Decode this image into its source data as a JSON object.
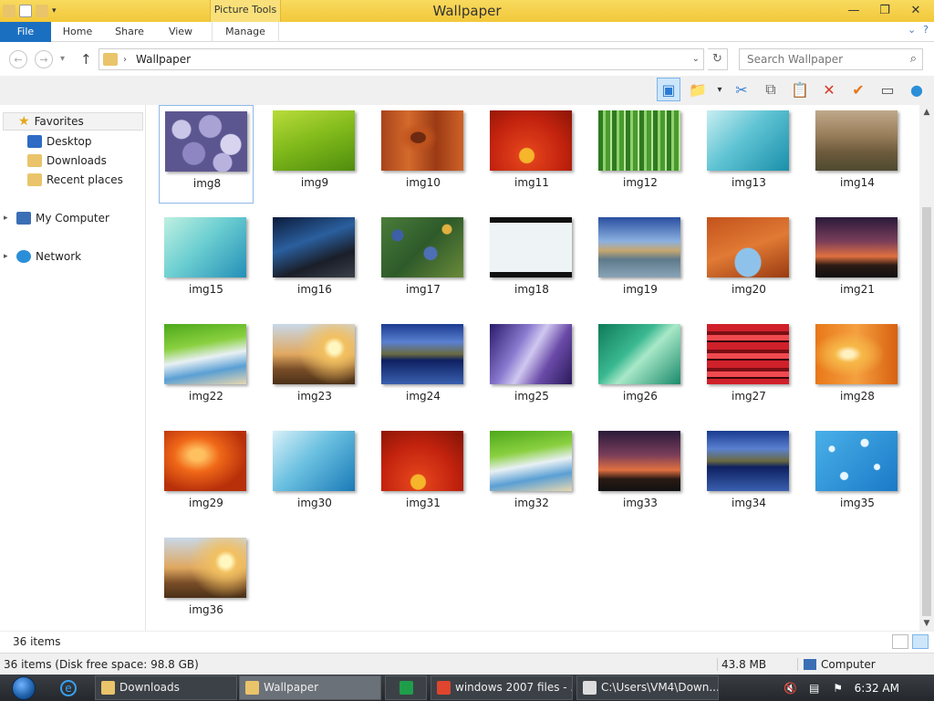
{
  "window": {
    "title": "Wallpaper",
    "context_tab": "Picture Tools",
    "minimize": "—",
    "maximize": "❐",
    "close": "✕"
  },
  "ribbon": {
    "tabs": [
      "File",
      "Home",
      "Share",
      "View",
      "Manage"
    ],
    "collapse_icon": "⌄",
    "help_icon": "?"
  },
  "address": {
    "back": "←",
    "forward": "→",
    "recent": "▾",
    "up": "↑",
    "separator": "›",
    "path": "Wallpaper",
    "dropdown": "⌄",
    "refresh": "↻",
    "search_placeholder": "Search Wallpaper",
    "search_icon": "⌕"
  },
  "toolbar": {
    "icons": [
      {
        "name": "preview-pane-icon",
        "glyph": "▣",
        "color": "#2a7bd4",
        "selected": true
      },
      {
        "name": "folder-options-icon",
        "glyph": "📁",
        "color": "#c99a2e",
        "selected": false
      },
      {
        "name": "dropdown-arrow-icon",
        "glyph": "▾",
        "color": "#333333",
        "selected": false
      },
      {
        "name": "cut-icon",
        "glyph": "✂",
        "color": "#3a7fd0",
        "selected": false
      },
      {
        "name": "copy-icon",
        "glyph": "⧉",
        "color": "#666666",
        "selected": false
      },
      {
        "name": "paste-icon",
        "glyph": "📋",
        "color": "#9a7a3c",
        "selected": false
      },
      {
        "name": "delete-icon",
        "glyph": "✕",
        "color": "#d63a2a",
        "selected": false
      },
      {
        "name": "rename-check-icon",
        "glyph": "✔",
        "color": "#e6761c",
        "selected": false
      },
      {
        "name": "properties-icon",
        "glyph": "▭",
        "color": "#555555",
        "selected": false
      },
      {
        "name": "globe-icon",
        "glyph": "●",
        "color": "#2b8fd8",
        "selected": false
      }
    ]
  },
  "nav": {
    "favorites": "Favorites",
    "desktop": "Desktop",
    "downloads": "Downloads",
    "recent": "Recent places",
    "computer": "My Computer",
    "network": "Network",
    "expand_icon": "▸"
  },
  "files": [
    {
      "label": "img8",
      "bg": "radial-gradient(circle at 20% 30%,#c9c6e8 0 10px,transparent 11px),radial-gradient(circle at 55% 25%,#a8a3d4 0 12px,transparent 13px),radial-gradient(circle at 80% 55%,#d8d4f0 0 11px,transparent 12px),radial-gradient(circle at 35% 70%,#8d86c2 0 12px,transparent 13px),radial-gradient(circle at 70% 85%,#b7b2de 0 10px,transparent 11px),#5c5690"
    },
    {
      "label": "img9",
      "bg": "linear-gradient(160deg,#b8dc3a 0%,#7fb81a 50%,#4f8d0e 100%)"
    },
    {
      "label": "img10",
      "bg": "radial-gradient(ellipse at 45% 45%,#6d2a10 0 8px,#c0531d 9px,transparent 22px),linear-gradient(90deg,#a8441a,#d46a2c,#9c3a14,#cf6228)"
    },
    {
      "label": "img11",
      "bg": "radial-gradient(circle at 45% 75%,#f6b52a 0 8px,#e0401a 9px,#c3230e 40px,#8a1506 70px)"
    },
    {
      "label": "img12",
      "bg": "repeating-linear-gradient(90deg,#2f7a22 0 5px,#8fd16a 5px 8px,#4a9a30 8px 13px,#b8e59a 13px 15px)"
    },
    {
      "label": "img13",
      "bg": "linear-gradient(135deg,#c8eef2 0%,#5fc3d3 45%,#1a8fab 100%)"
    },
    {
      "label": "img14",
      "bg": "linear-gradient(180deg,#bfa88a 0%,#9a7f5c 40%,#6d5a3c 70%,#4e4a30 100%)"
    },
    {
      "label": "img15",
      "bg": "linear-gradient(135deg,#bff0e2 0%,#6dcfd1 45%,#248fb8 100%)"
    },
    {
      "label": "img16",
      "bg": "linear-gradient(160deg,#0c1b3a 0%,#2a5f9e 40%,#1a1e28 70%,#3b3f48 100%)"
    },
    {
      "label": "img17",
      "bg": "radial-gradient(circle at 20% 30%,#3d5fa8 0 6px,transparent 7px),radial-gradient(circle at 60% 60%,#4d6fb5 0 7px,transparent 8px),radial-gradient(circle at 80% 20%,#e0b040 0 5px,transparent 6px),linear-gradient(135deg,#4a7d3a,#2e5a2a,#6a8a3a)"
    },
    {
      "label": "img18",
      "bg": "linear-gradient(180deg,#111 0 6px,#eef3f6 6px 60px,#111 60px),radial-gradient(ellipse at 50% 55%,#4a7aa0 0 30px,transparent 31px)"
    },
    {
      "label": "img19",
      "bg": "linear-gradient(180deg,#2a4fa0 0%,#8bb0e0 40%,#c7a870 55%,#5e7a8a 70%,#8aa4b8 100%)"
    },
    {
      "label": "img20",
      "bg": "radial-gradient(ellipse at 50% 75%,#8fc2ea 0 14px,transparent 15px),linear-gradient(160deg,#c4521c,#e07a34,#9a3a12)"
    },
    {
      "label": "img21",
      "bg": "linear-gradient(180deg,#2a1a3a 0%,#7a3e5a 40%,#e07040 65%,#2a1a14 80%,#111 100%)"
    },
    {
      "label": "img22",
      "bg": "linear-gradient(170deg,#4ca81a 0%,#8ad040 35%,#e8f0f4 55%,#5a9fd4 75%,#e8d8b0 100%)"
    },
    {
      "label": "img23",
      "bg": "radial-gradient(circle at 75% 40%,#fff6c0 0 6px,#f2c060 12px,transparent 40px),linear-gradient(180deg,#c8d8e8 0%,#e0a860 50%,#7a4e28 75%,#4a3018 100%)"
    },
    {
      "label": "img24",
      "bg": "linear-gradient(180deg,#1a3a90 0%,#5a80d0 30%,#6a6a40 50%,#0e2060 60%,#3a60b0 100%)"
    },
    {
      "label": "img25",
      "bg": "linear-gradient(120deg,#2a1a6a 0%,#8a7ad0 35%,#d0c8f0 50%,#6a4aa8 70%,#2a1a5a 100%)"
    },
    {
      "label": "img26",
      "bg": "linear-gradient(135deg,#0e7a58 0%,#3ab890 40%,#a8e8c8 55%,#1a8a6a 100%)"
    },
    {
      "label": "img27",
      "bg": "repeating-linear-gradient(180deg,#d0202a 0 8px,#7a0e14 8px 12px,#f04a50 12px 18px,#3a0608 18px 20px)"
    },
    {
      "label": "img28",
      "bg": "radial-gradient(ellipse at 40% 50%,#fff0c0 0 6px,#f6b848 15px,transparent 40px),linear-gradient(90deg,#e8781a,#f5a040,#d86010)"
    },
    {
      "label": "img29",
      "bg": "radial-gradient(ellipse at 40% 40%,#ffc060 0 8px,#f06818 25px,#b8300a 55px)"
    },
    {
      "label": "img30",
      "bg": "linear-gradient(135deg,#d8f0f8 0%,#6ac0e0 45%,#1a7ab8 100%)"
    },
    {
      "label": "img31",
      "bg": "radial-gradient(circle at 45% 85%,#f6b52a 0 8px,#e0401a 9px,#c3230e 40px,#8a1506 70px)"
    },
    {
      "label": "img32",
      "bg": "linear-gradient(170deg,#4ca81a 0%,#8ad040 35%,#e8f0f4 55%,#5a9fd4 75%,#e8d8b0 100%)"
    },
    {
      "label": "img33",
      "bg": "linear-gradient(180deg,#2a1a3a 0%,#7a3e5a 40%,#e07040 65%,#2a1a14 80%,#111 100%)"
    },
    {
      "label": "img34",
      "bg": "linear-gradient(180deg,#1a3a90 0%,#5a80d0 30%,#6a6a40 50%,#0e2060 60%,#3a60b0 100%)"
    },
    {
      "label": "img35",
      "bg": "radial-gradient(circle at 20% 30%,#e8f6ff 0 3px,transparent 4px),radial-gradient(circle at 60% 20%,#e8f6ff 0 4px,transparent 5px),radial-gradient(circle at 75% 60%,#e8f6ff 0 3px,transparent 4px),radial-gradient(circle at 35% 75%,#e8f6ff 0 4px,transparent 5px),linear-gradient(135deg,#4ab0e8,#1a7ac8)"
    },
    {
      "label": "img36",
      "bg": "radial-gradient(circle at 75% 40%,#fff6c0 0 6px,#f2c060 12px,transparent 40px),linear-gradient(180deg,#c8d8e8 0%,#e0a860 50%,#7a4e28 75%,#4a3018 100%)"
    }
  ],
  "items_count": "36 items",
  "status": {
    "left": "36 items (Disk free space: 98.8 GB)",
    "size": "43.8 MB",
    "computer": "Computer"
  },
  "taskbar": {
    "buttons": [
      {
        "label": "Downloads",
        "icon_color": "#e9c46a",
        "active": false
      },
      {
        "label": "Wallpaper",
        "icon_color": "#e9c46a",
        "active": true
      },
      {
        "label": "",
        "icon_color": "#1f9e4a",
        "active": false
      },
      {
        "label": "windows 2007 files - ...",
        "icon_color": "#e0452e",
        "active": false
      },
      {
        "label": "C:\\Users\\VM4\\Down...",
        "icon_color": "#dddddd",
        "active": false
      }
    ],
    "clock": "6:32 AM"
  },
  "colors": {
    "title_bar": "#f6d34f",
    "file_tab": "#1a6fc1",
    "selection": "#cde6fa"
  }
}
